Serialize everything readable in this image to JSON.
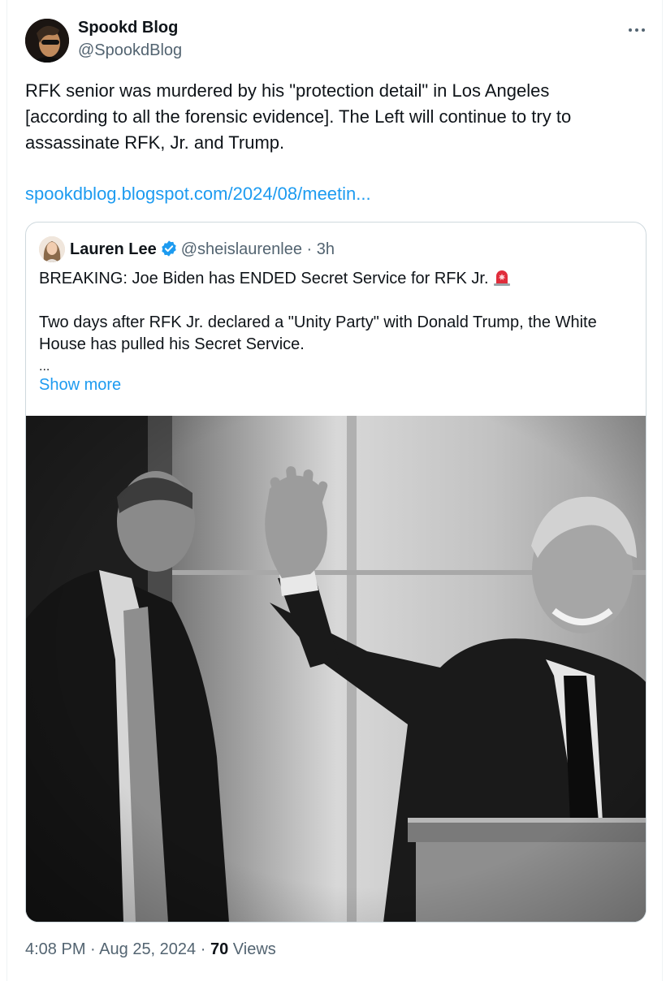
{
  "author": {
    "name": "Spookd Blog",
    "handle": "@SpookdBlog",
    "avatar_icon": "user-avatar-photo"
  },
  "more_icon": "more-horizontal-icon",
  "tweet": {
    "text_lines": [
      "RFK senior was murdered by his \"protection detail\" in Los Angeles",
      "[according to all the forensic evidence].  The Left will continue to try to",
      "assassinate RFK, Jr. and Trump."
    ],
    "link": "spookdblog.blogspot.com/2024/08/meetin..."
  },
  "quote": {
    "name": "Lauren Lee",
    "verified_icon": "verified-badge-icon",
    "handle": "@sheislaurenlee",
    "separator": "·",
    "time": "3h",
    "line1": "BREAKING: Joe Biden has ENDED Secret Service for RFK Jr.",
    "siren_icon": "rotating-light-emoji",
    "line2": "Two days after RFK Jr. declared a \"Unity Party\" with Donald Trump, the White",
    "line3": "House has pulled his Secret Service.",
    "ellipsis": "...",
    "show_more": "Show more",
    "photo": "black-and-white-photo-man-waving-with-bodyguard"
  },
  "meta": {
    "time": "4:08 PM",
    "sep1": "·",
    "date": "Aug 25, 2024",
    "sep2": "·",
    "views_count": "70",
    "views_label": "Views"
  },
  "colors": {
    "text": "#0f1419",
    "secondary": "#536471",
    "link": "#1d9bf0",
    "border": "#cfd9de"
  }
}
